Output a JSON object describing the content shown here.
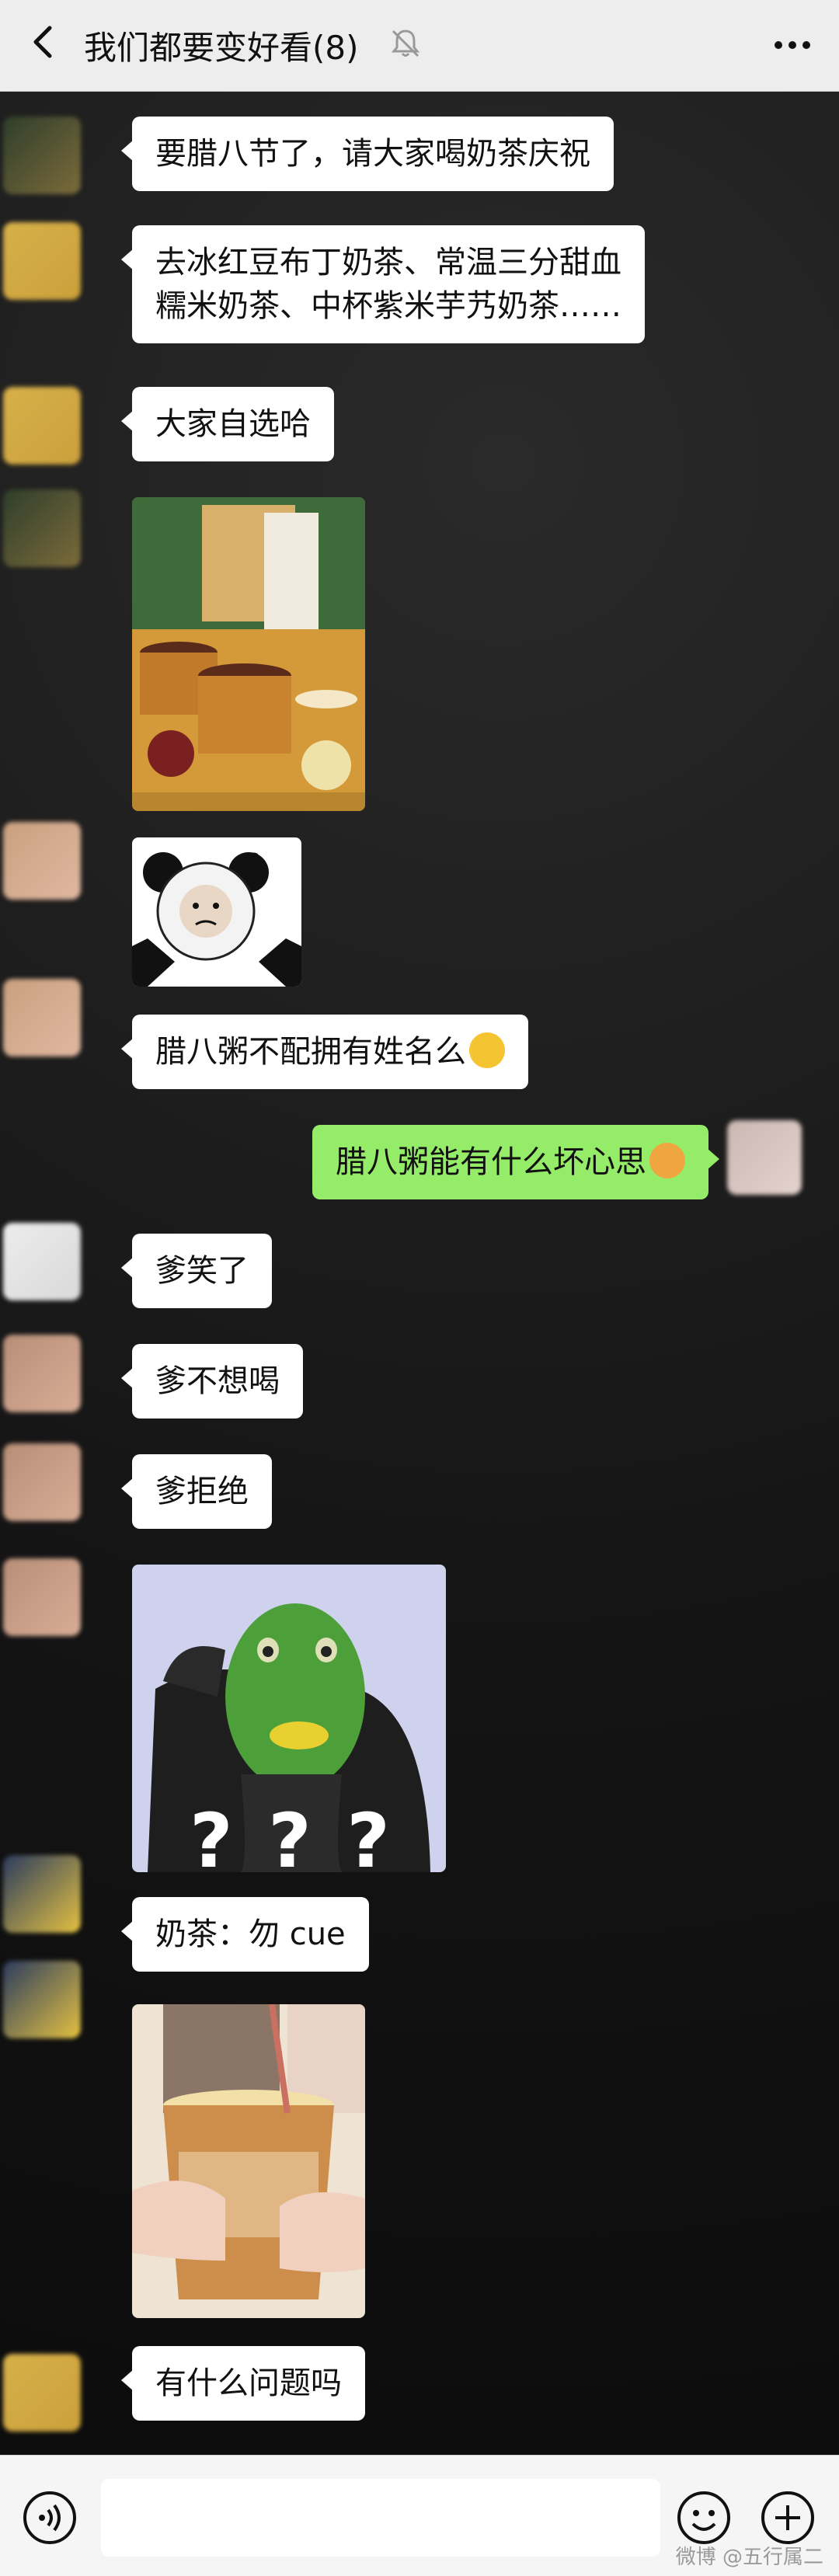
{
  "header": {
    "title": "我们都要变好看(8)"
  },
  "messages": {
    "m1": "要腊八节了，请大家喝奶茶庆祝",
    "m2_line1": "去冰红豆布丁奶茶、常温三分甜血",
    "m2_line2": "糯米奶茶、中杯紫米芋艿奶茶……",
    "m3": "大家自选哈",
    "m5": "腊八粥不配拥有姓名么",
    "m6": "腊八粥能有什么坏心思",
    "m7": "爹笑了",
    "m8": "爹不想喝",
    "m9": "爹拒绝",
    "m10_overlay": "? ? ?",
    "m11": "奶茶：勿 cue",
    "m13": "有什么问题吗"
  },
  "icons": {
    "back": "chevron-left-icon",
    "mute": "bell-muted-icon",
    "more": "more-icon",
    "voice": "voice-icon",
    "emoji": "emoji-icon",
    "plus": "plus-icon"
  },
  "colors": {
    "self_bubble": "#95ec69",
    "other_bubble": "#ffffff",
    "header_bg": "#ededed"
  },
  "watermark": "微博 @五行属二"
}
